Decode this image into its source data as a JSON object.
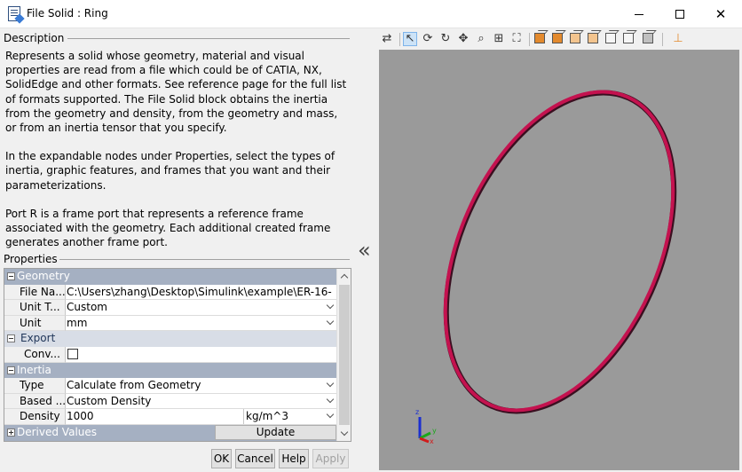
{
  "window": {
    "title": "File Solid : Ring",
    "icon": "document-edit-icon"
  },
  "description": {
    "legend": "Description",
    "paragraphs": [
      "Represents a solid whose geometry, material and visual properties are read from a file which could be of CATIA, NX, SolidEdge and other formats. See reference page for the full list of formats supported. The File Solid block obtains the inertia from the geometry and density, from the geometry and mass, or from an inertia tensor that you specify.",
      "In the expandable nodes under Properties, select the types of inertia, graphic features, and frames that you want and their parameterizations.",
      "Port R is a frame port that represents a reference frame associated with the geometry. Each additional created frame generates another frame port."
    ]
  },
  "properties": {
    "legend": "Properties",
    "geometry": {
      "label": "Geometry",
      "file_name_label": "File Na...",
      "file_name_value": "C:\\Users\\zhang\\Desktop\\Simulink\\example\\ER-16-...",
      "unit_type_label": "Unit T...",
      "unit_type_value": "Custom",
      "unit_label": "Unit",
      "unit_value": "mm"
    },
    "export": {
      "label": "Export",
      "convert_label": "Conv..."
    },
    "inertia": {
      "label": "Inertia",
      "type_label": "Type",
      "type_value": "Calculate from Geometry",
      "based_label": "Based ...",
      "based_value": "Custom Density",
      "density_label": "Density",
      "density_value": "1000",
      "density_unit": "kg/m^3"
    },
    "derived": {
      "label": "Derived Values",
      "update_label": "Update"
    }
  },
  "buttons": {
    "ok": "OK",
    "cancel": "Cancel",
    "help": "Help",
    "apply": "Apply"
  },
  "viewer": {
    "background": "#9a9a9a",
    "ring_color": "#c4124f",
    "axes": {
      "z": "z",
      "y": "y",
      "x": "x"
    }
  }
}
